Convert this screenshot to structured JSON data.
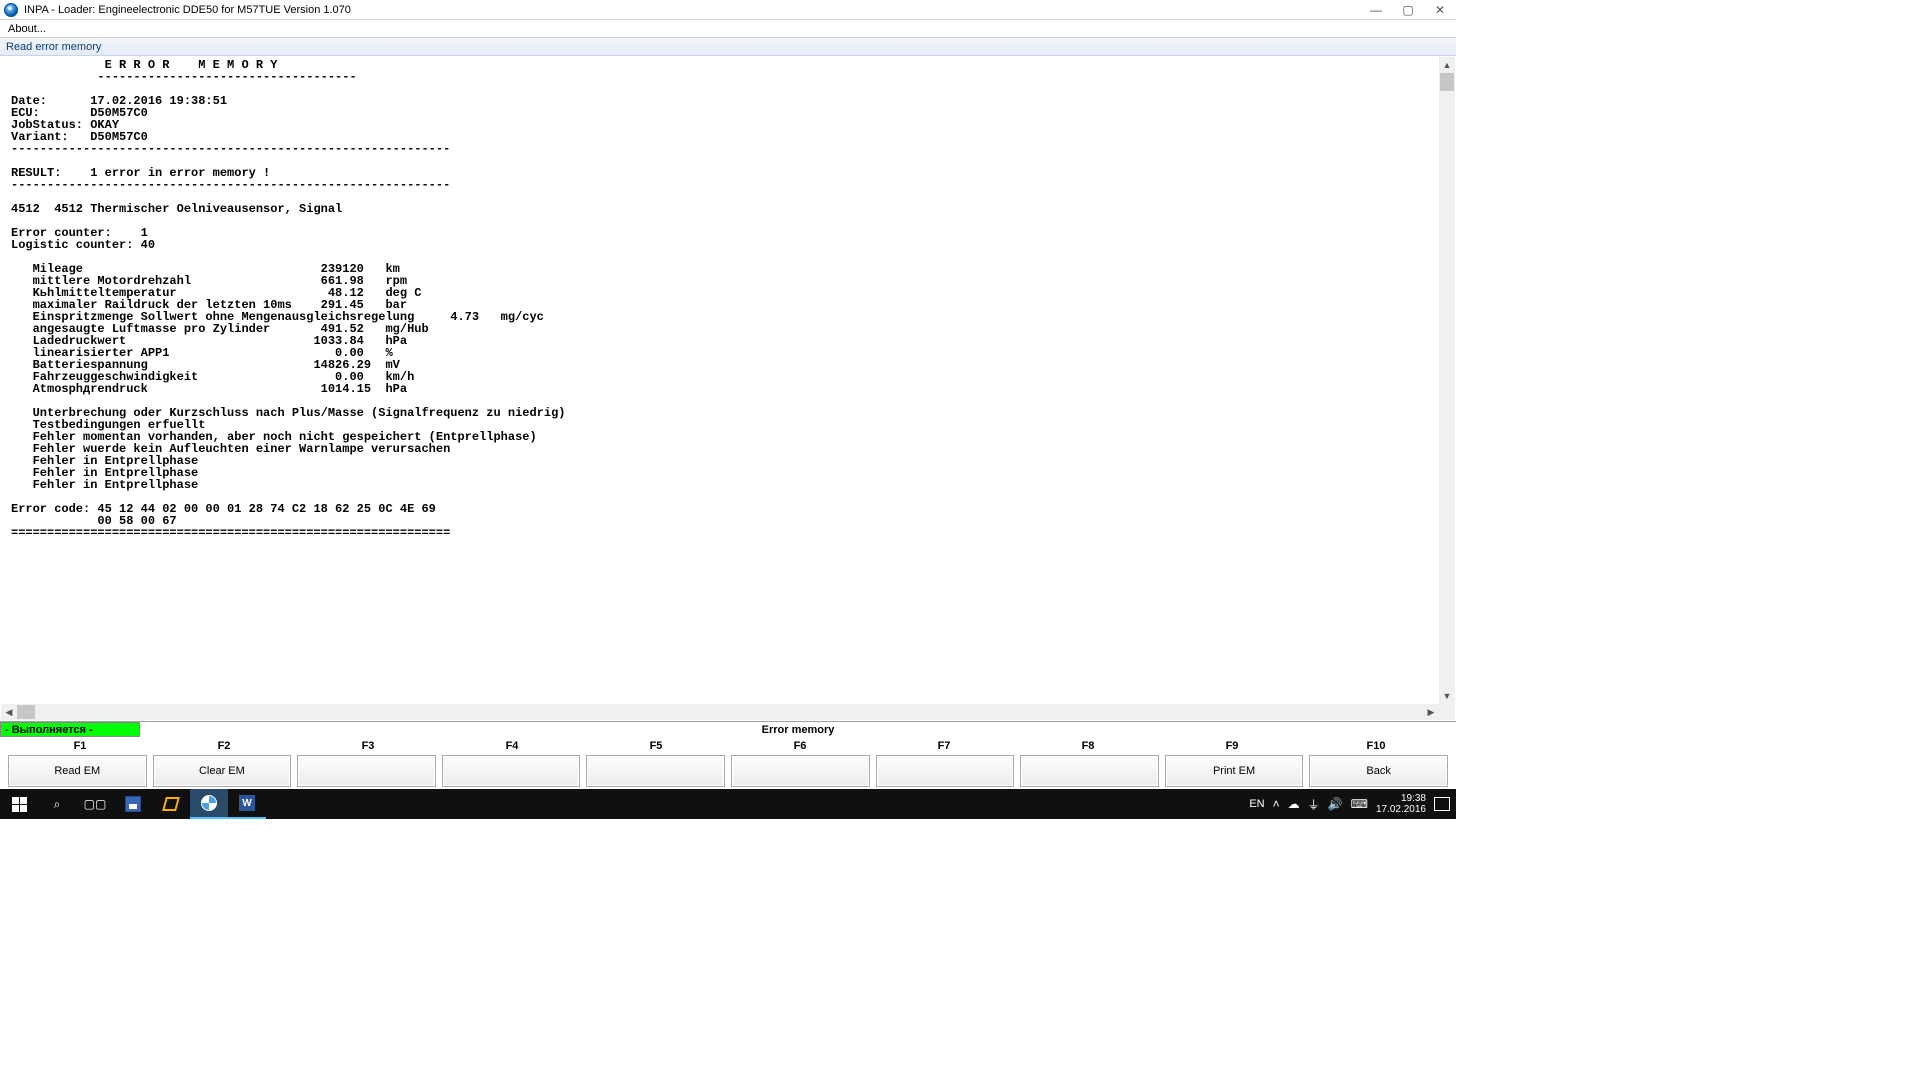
{
  "window": {
    "title": "INPA - Loader:  Engineelectronic DDE50 for M57TUE Version 1.070"
  },
  "menu": {
    "about": "About..."
  },
  "subtitle": "Read error memory",
  "report": {
    "header1": "             E R R O R    M E M O R Y",
    "header2": "            ------------------------------------",
    "blank": "",
    "date_line": "Date:      17.02.2016 19:38:51",
    "ecu_line": "ECU:       D50M57C0",
    "job_line": "JobStatus: OKAY",
    "variant_line": "Variant:   D50M57C0",
    "sep1": "-------------------------------------------------------------",
    "result_line": "RESULT:    1 error in error memory !",
    "sep2": "-------------------------------------------------------------",
    "fault_line": "4512  4512 Thermischer Oelniveausensor, Signal",
    "err_counter": "Error counter:    1",
    "log_counter": "Logistic counter: 40",
    "p_mileage": "   Mileage                                 239120   km",
    "p_rpm": "   mittlere Motordrehzahl                  661.98   rpm",
    "p_coolant": "   Kьhlmitteltemperatur                     48.12   deg C",
    "p_rail": "   maximaler Raildruck der letzten 10ms    291.45   bar",
    "p_inj": "   Einspritzmenge Sollwert ohne Mengenausgleichsregelung     4.73   mg/cyc",
    "p_air": "   angesaugte Luftmasse pro Zylinder       491.52   mg/Hub",
    "p_boost": "   Ladedruckwert                          1033.84   hPa",
    "p_app1": "   linearisierter APP1                       0.00   %",
    "p_batt": "   Batteriespannung                       14826.29  mV",
    "p_speed": "   Fahrzeuggeschwindigkeit                   0.00   km/h",
    "p_atm": "   Atmosphдrendruck                        1014.15  hPa",
    "s1": "   Unterbrechung oder Kurzschluss nach Plus/Masse (Signalfrequenz zu niedrig)",
    "s2": "   Testbedingungen erfuellt",
    "s3": "   Fehler momentan vorhanden, aber noch nicht gespeichert (Entprellphase)",
    "s4": "   Fehler wuerde kein Aufleuchten einer Warnlampe verursachen",
    "s5": "   Fehler in Entprellphase",
    "s6": "   Fehler in Entprellphase",
    "s7": "   Fehler in Entprellphase",
    "code1": "Error code: 45 12 44 02 00 00 01 28 74 C2 18 62 25 0C 4E 69",
    "code2": "            00 58 00 67",
    "sep3": "============================================================="
  },
  "status": {
    "exec": "- Выполняется -",
    "center": "Error memory"
  },
  "fkeys": {
    "labels": [
      "F1",
      "F2",
      "F3",
      "F4",
      "F5",
      "F6",
      "F7",
      "F8",
      "F9",
      "F10"
    ],
    "buttons": [
      "Read EM",
      "Clear EM",
      "",
      "",
      "",
      "",
      "",
      "",
      "Print EM",
      "Back"
    ]
  },
  "taskbar": {
    "lang": "EN",
    "time": "19:38",
    "date": "17.02.2016"
  }
}
